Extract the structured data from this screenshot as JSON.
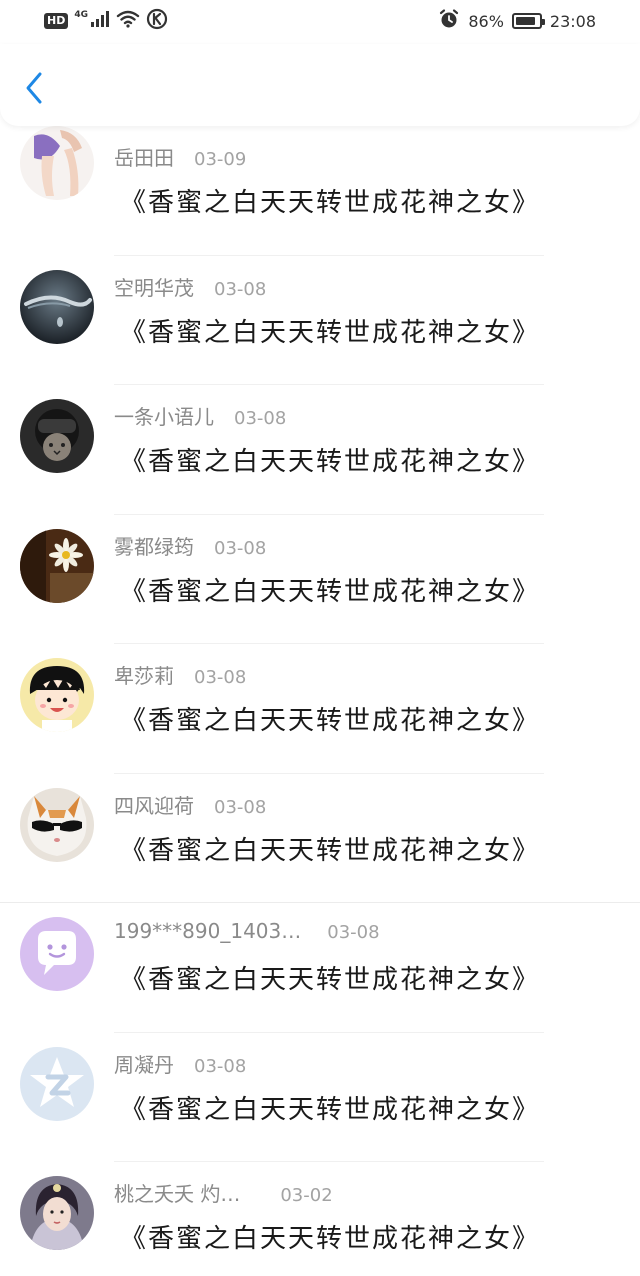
{
  "status_bar": {
    "hd": "HD",
    "network": "4G",
    "signal_icon": "signal-bars-icon",
    "wifi_icon": "wifi-icon",
    "extra_icon": "k-circle-icon",
    "alarm_icon": "alarm-clock-icon",
    "battery_text": "86%",
    "battery_level": 0.86,
    "time": "23:08"
  },
  "header": {
    "back_icon": "chevron-left-icon",
    "accent_color": "#1E88E5"
  },
  "comments": [
    {
      "user": "岳田田",
      "date": "03-09",
      "text": "《香蜜之白天天转世成花神之女》",
      "avatar": "photo-legs"
    },
    {
      "user": "空明华茂",
      "date": "03-08",
      "text": "《香蜜之白天天转世成花神之女》",
      "avatar": "photo-water-drop"
    },
    {
      "user": "一条小语儿",
      "date": "03-08",
      "text": "《香蜜之白天天转世成花神之女》",
      "avatar": "photo-cat-helmet"
    },
    {
      "user": "雾都绿筠",
      "date": "03-08",
      "text": "《香蜜之白天天转世成花神之女》",
      "avatar": "photo-daisy"
    },
    {
      "user": "卑莎莉",
      "date": "03-08",
      "text": "《香蜜之白天天转世成花神之女》",
      "avatar": "cartoon-girl"
    },
    {
      "user": "四风迎荷",
      "date": "03-08",
      "text": "《香蜜之白天天转世成花神之女》",
      "avatar": "photo-cat-sunglasses"
    },
    {
      "user": "199***890_1403…",
      "date": "03-08",
      "text": "《香蜜之白天天转世成花神之女》",
      "avatar": "default-purple"
    },
    {
      "user": "周凝丹",
      "date": "03-08",
      "text": "《香蜜之白天天转世成花神之女》",
      "avatar": "default-qzone"
    },
    {
      "user": "桃之夭夭 灼…",
      "date": "03-02",
      "text": "《香蜜之白天天转世成花神之女》",
      "avatar": "photo-costume"
    }
  ]
}
